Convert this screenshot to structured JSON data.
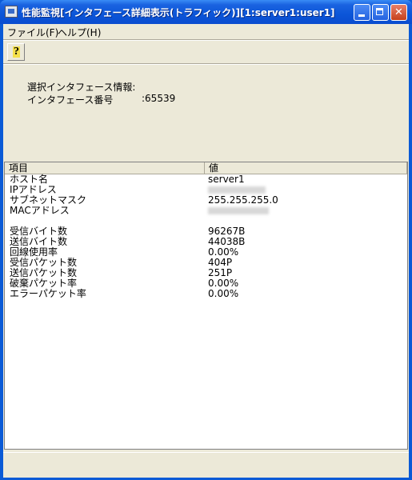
{
  "window": {
    "title": "性能監視[インタフェース詳細表示(トラフィック)][1:server1:user1]"
  },
  "menu": {
    "file": "ファイル(F)",
    "help": "ヘルプ(H)"
  },
  "toolbar": {
    "help_glyph": "?"
  },
  "info": {
    "heading": "選択インタフェース情報:",
    "interface_label": "インタフェース番号",
    "interface_value": ":65539"
  },
  "list": {
    "columns": {
      "item": "項目",
      "value": "値"
    },
    "rows": [
      {
        "key": "ホスト名",
        "value": "server1"
      },
      {
        "key": "IPアドレス",
        "value": "",
        "redacted": true
      },
      {
        "key": "サブネットマスク",
        "value": "255.255.255.0"
      },
      {
        "key": "MACアドレス",
        "value": "",
        "redacted": true
      },
      {
        "key": "",
        "value": ""
      },
      {
        "key": "受信バイト数",
        "value": "96267B"
      },
      {
        "key": "送信バイト数",
        "value": "44038B"
      },
      {
        "key": "回線使用率",
        "value": "0.00%"
      },
      {
        "key": "受信パケット数",
        "value": "404P"
      },
      {
        "key": "送信パケット数",
        "value": "251P"
      },
      {
        "key": "破棄パケット率",
        "value": "0.00%"
      },
      {
        "key": "エラーパケット率",
        "value": "0.00%"
      }
    ]
  }
}
